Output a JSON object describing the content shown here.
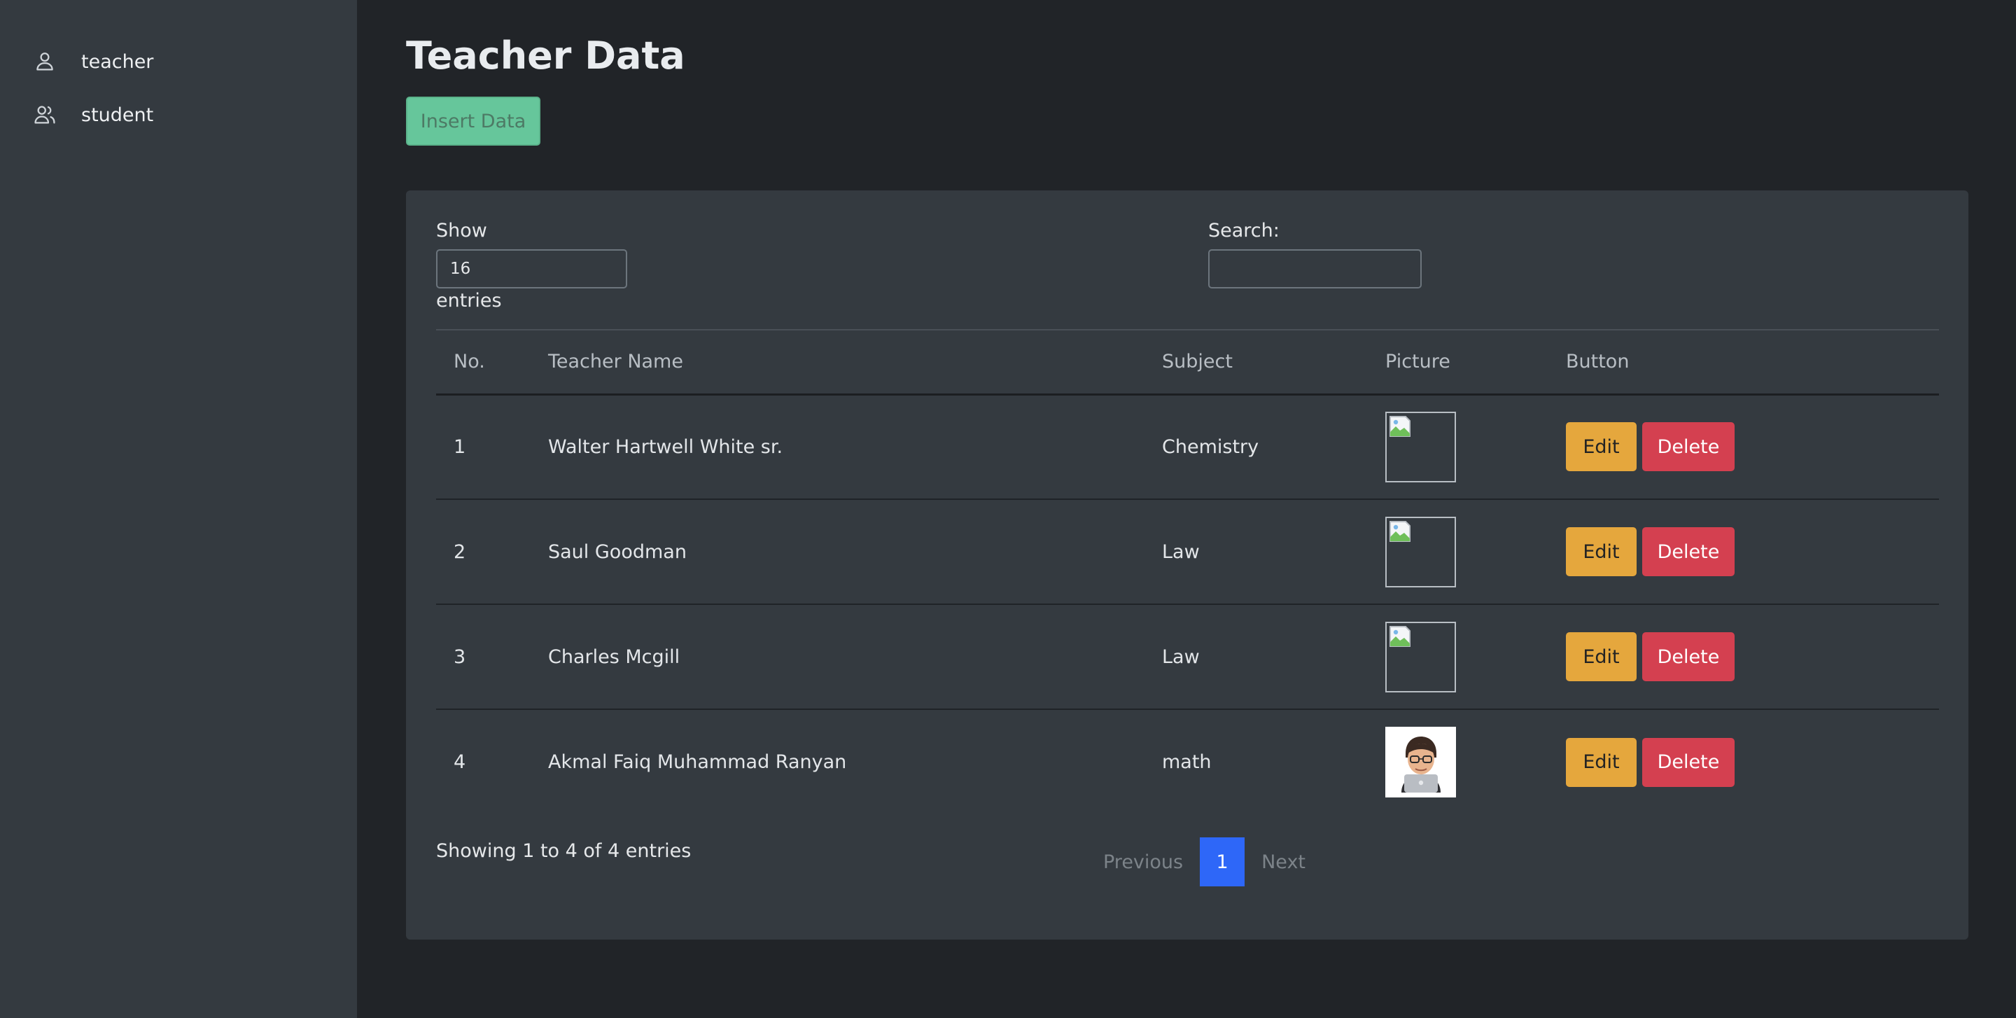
{
  "sidebar": {
    "items": [
      {
        "label": "teacher",
        "icon": "user-icon"
      },
      {
        "label": "student",
        "icon": "users-icon"
      }
    ]
  },
  "page": {
    "title": "Teacher Data",
    "insert_button": "Insert Data"
  },
  "controls": {
    "show_label": "Show",
    "entries_value": "16",
    "entries_label": "entries",
    "search_label": "Search:",
    "search_value": ""
  },
  "table": {
    "headers": [
      "No.",
      "Teacher Name",
      "Subject",
      "Picture",
      "Button"
    ],
    "rows": [
      {
        "no": "1",
        "name": "Walter Hartwell White sr.",
        "subject": "Chemistry",
        "picture": "broken-image",
        "edit": "Edit",
        "delete": "Delete"
      },
      {
        "no": "2",
        "name": "Saul Goodman",
        "subject": "Law",
        "picture": "broken-image",
        "edit": "Edit",
        "delete": "Delete"
      },
      {
        "no": "3",
        "name": "Charles Mcgill",
        "subject": "Law",
        "picture": "broken-image",
        "edit": "Edit",
        "delete": "Delete"
      },
      {
        "no": "4",
        "name": "Akmal Faiq Muhammad Ranyan",
        "subject": "math",
        "picture": "memoji-avatar",
        "edit": "Edit",
        "delete": "Delete"
      }
    ]
  },
  "footer": {
    "info": "Showing 1 to 4 of 4 entries",
    "previous": "Previous",
    "current_page": "1",
    "next": "Next"
  },
  "colors": {
    "background": "#212428",
    "sidebar": "#343a40",
    "card": "#343a40",
    "insert_button": "#66c69b",
    "edit_button": "#e5a73d",
    "delete_button": "#d44050",
    "page_active": "#2e67f8"
  }
}
